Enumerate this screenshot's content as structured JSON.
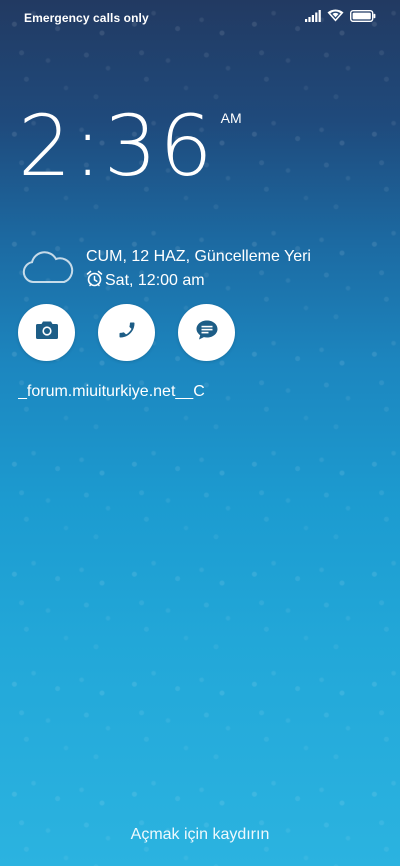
{
  "status_bar": {
    "carrier_text": "Emergency calls only",
    "icons": [
      "signal-icon",
      "wifi-icon",
      "battery-icon"
    ]
  },
  "clock": {
    "time": "2:36",
    "ampm": "AM"
  },
  "weather": {
    "icon": "cloud-icon",
    "date_location": "CUM, 12 HAZ, Güncelleme Yeri",
    "alarm_icon": "alarm-clock-icon",
    "alarm_text": "Sat, 12:00 am"
  },
  "shortcuts": [
    {
      "name": "camera",
      "icon": "camera-icon"
    },
    {
      "name": "phone",
      "icon": "phone-icon"
    },
    {
      "name": "messages",
      "icon": "message-icon"
    }
  ],
  "owner_info": "_forum.miuiturkiye.net__C",
  "unlock_hint": "Açmak için kaydırın",
  "colors": {
    "icon_dark": "#1d5d86",
    "text": "#ffffff"
  }
}
